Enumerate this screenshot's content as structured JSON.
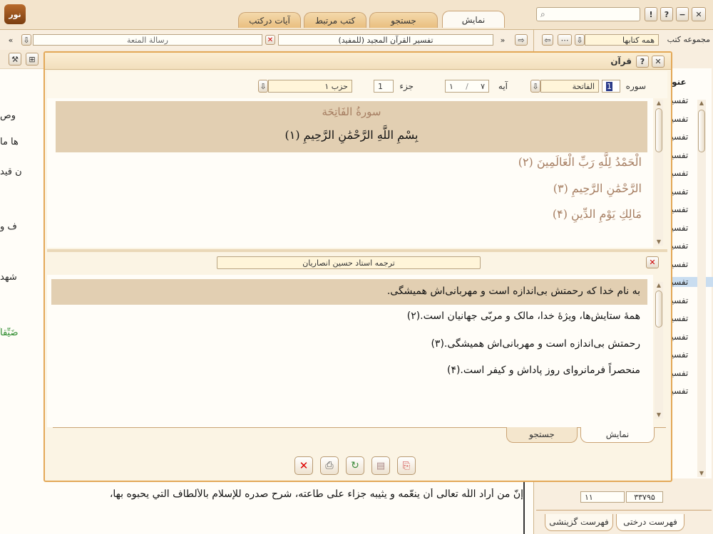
{
  "app": {
    "logo_glyph": "نور",
    "search_placeholder": ""
  },
  "window_buttons": {
    "close": "✕",
    "minimize": "−",
    "help": "?",
    "info": "!"
  },
  "top_tabs": [
    {
      "label": "نمایش",
      "active": true
    },
    {
      "label": "جستجو",
      "active": false
    },
    {
      "label": "کتب مرتبط",
      "active": false
    },
    {
      "label": "آیات درکتب",
      "active": false
    }
  ],
  "book_bar": {
    "left_book": "رسالة المتعة",
    "right_book": "تفسير القرآن المجيد (للمفيد)"
  },
  "right_panel": {
    "collection_label": "مجموعه کتب",
    "collection_value": "همه کتابها",
    "header_label": "عنوا",
    "items": [
      "تفسيـ",
      "تفسيـ",
      "تفسيـ",
      "تفسيـ",
      "تفسيـ",
      "تفسيـ",
      "تفسيـ",
      "تفسيـ",
      "تفسيـ",
      "تفسيـ",
      "تفسيـ",
      "تفسيـ",
      "تفسيـ",
      "تفسيـ",
      "تفسيـ",
      "تفسيـ",
      "تفسيـ"
    ],
    "bottom_field_left": "۳۳۷۹۵",
    "bottom_field_right": "۱۱",
    "tab_tree": "فهرست درختی",
    "tab_selected": "فهرست گزینشی"
  },
  "background_text": {
    "lines": [
      "وص",
      "ها ما",
      "ن قيد",
      "ف و",
      "شهد",
      "ضَيِّقاً"
    ],
    "bottom_line": "إنّ من أراد اللّه تعالى أن ينعّمه و يثيبه جزاء على طاعته، شرح صدره للإسلام بالألطاف التي يحبوه بها،"
  },
  "quran_dialog": {
    "title": "قرآن",
    "sura_label": "سوره",
    "sura_number": "1",
    "sura_name": "الفاتحة",
    "aya_label": "آیه",
    "aya_from": "۱",
    "aya_to": "۷",
    "juz_label": "جزء",
    "juz_value": "1",
    "hizb_value": "حزب ۱",
    "sura_heading": "سورةُ الفَاتِحَة",
    "verses": [
      "بِسْمِ اللَّهِ الرَّحْمَٰنِ الرَّحِيمِ (۱)",
      "الْحَمْدُ لِلَّهِ رَبِّ الْعَالَمِينَ (۲)",
      "الرَّحْمَٰنِ الرَّحِيمِ (۳)",
      "مَالِكِ يَوْمِ الدِّينِ (۴)"
    ],
    "translator": "ترجمه استاد حسین انصاریان",
    "translations": [
      "به نام خدا که رحمتش بی‌اندازه است و مهربانی‌اش همیشگی.",
      "همهٔ ستایش‌ها، ویژهٔ خدا، مالک و مربّی جهانیان است.(۲)",
      "رحمتش بی‌اندازه است و مهربانی‌اش همیشگی.(۳)",
      "منحصراً فرمانروای روز پاداش و کیفر است.(۴)"
    ],
    "bottom_tab_view": "نمایش",
    "bottom_tab_search": "جستجو"
  },
  "colors": {
    "accent": "#e3a857",
    "highlight": "#e2cfb2",
    "verse": "#a67e62"
  }
}
